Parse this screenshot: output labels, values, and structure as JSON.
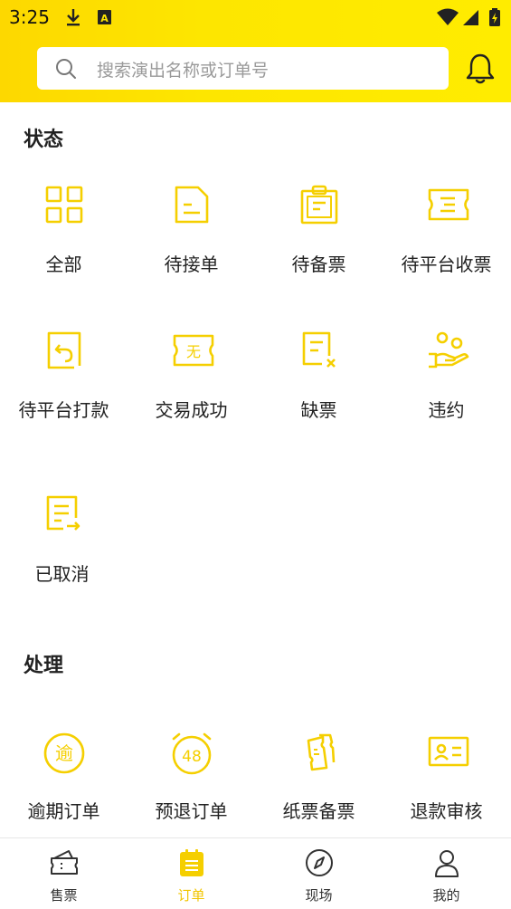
{
  "status_bar": {
    "time": "3:25"
  },
  "search": {
    "placeholder": "搜索演出名称或订单号"
  },
  "colors": {
    "accent": "#fde800",
    "icon": "#f5cf00",
    "active_tab": "#f2c500"
  },
  "status_section": {
    "title": "状态",
    "items": [
      {
        "label": "全部",
        "icon": "grid-icon"
      },
      {
        "label": "待接单",
        "icon": "document-icon"
      },
      {
        "label": "待备票",
        "icon": "clipboard-icon"
      },
      {
        "label": "待平台收票",
        "icon": "ticket-icon"
      },
      {
        "label": "待平台打款",
        "icon": "refund-icon"
      },
      {
        "label": "交易成功",
        "icon": "ticket-none-icon"
      },
      {
        "label": "缺票",
        "icon": "doc-cross-icon"
      },
      {
        "label": "违约",
        "icon": "hand-people-icon"
      },
      {
        "label": "已取消",
        "icon": "doc-arrow-icon"
      }
    ]
  },
  "process_section": {
    "title": "处理",
    "items": [
      {
        "label": "逾期订单",
        "icon": "overdue-icon",
        "glyph": "逾"
      },
      {
        "label": "预退订单",
        "icon": "alarm-clock-icon",
        "glyph": "48"
      },
      {
        "label": "纸票备票",
        "icon": "paper-ticket-icon"
      },
      {
        "label": "退款审核",
        "icon": "id-card-icon"
      }
    ]
  },
  "tabs": [
    {
      "label": "售票",
      "icon": "ticket-tab-icon"
    },
    {
      "label": "订单",
      "icon": "order-tab-icon",
      "active": true
    },
    {
      "label": "现场",
      "icon": "compass-icon"
    },
    {
      "label": "我的",
      "icon": "user-icon"
    }
  ]
}
